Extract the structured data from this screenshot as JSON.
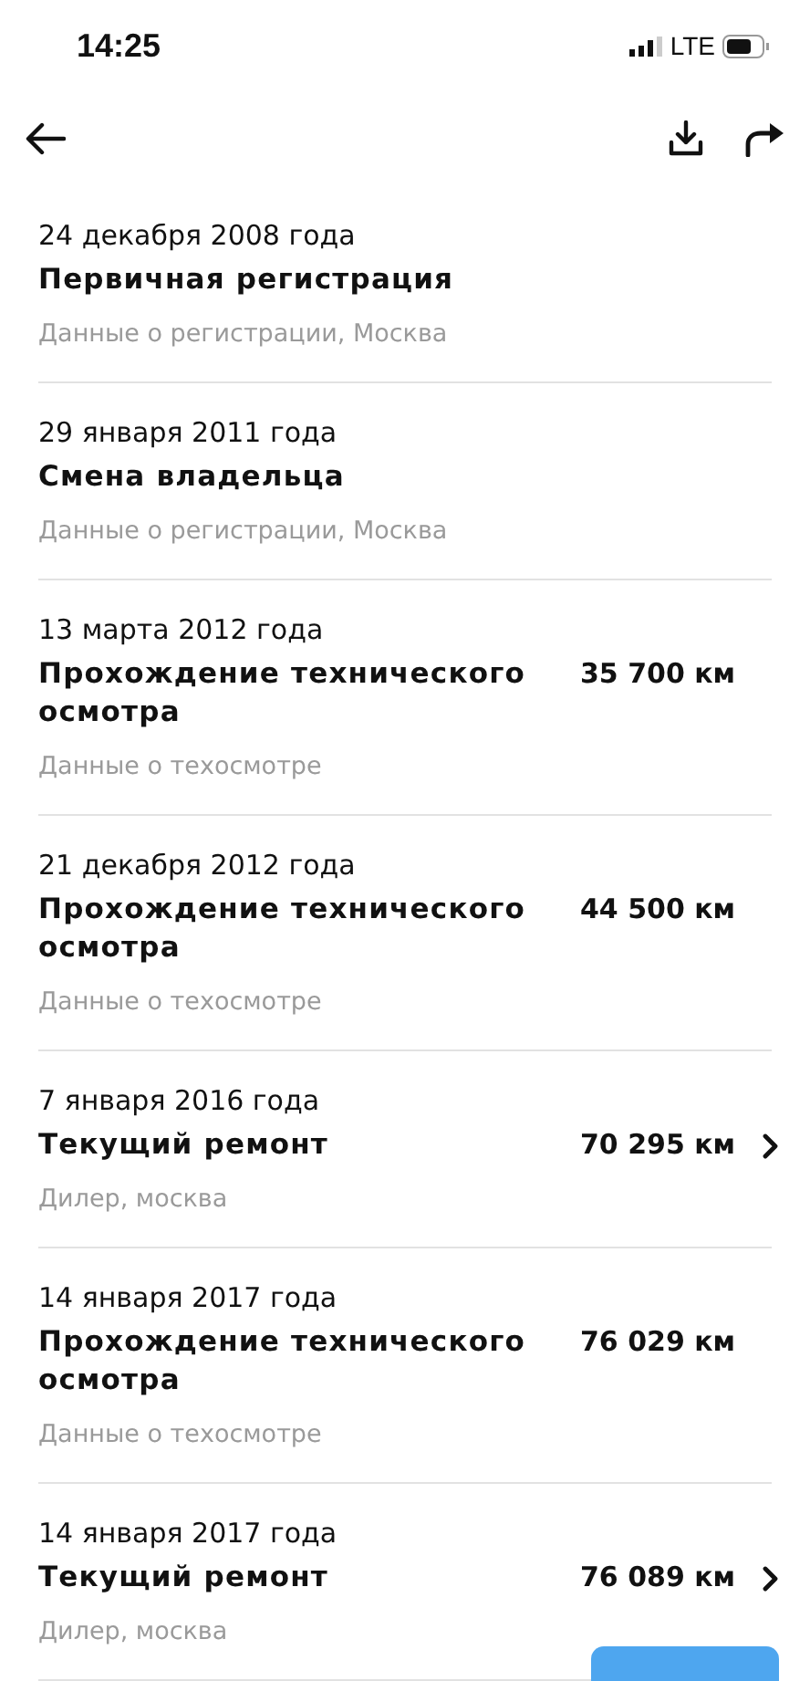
{
  "status_bar": {
    "time": "14:25",
    "network": "LTE"
  },
  "events": [
    {
      "date": "24 декабря 2008 года",
      "title": "Первичная регистрация",
      "source": "Данные о регистрации, Москва",
      "has_details": false
    },
    {
      "date": "29 января 2011 года",
      "title": "Смена владельца",
      "source": "Данные о регистрации, Москва",
      "has_details": false
    },
    {
      "date": "13 марта 2012 года",
      "title": "Прохождение технического осмотра",
      "source": "Данные о техосмотре",
      "mileage": "35 700 км",
      "has_details": false
    },
    {
      "date": "21 декабря 2012 года",
      "title": "Прохождение технического осмотра",
      "source": "Данные о техосмотре",
      "mileage": "44 500 км",
      "has_details": false
    },
    {
      "date": "7 января 2016 года",
      "title": "Текущий ремонт",
      "source": "Дилер, москва",
      "mileage": "70 295 км",
      "has_details": true
    },
    {
      "date": "14 января 2017 года",
      "title": "Прохождение технического осмотра",
      "source": "Данные о техосмотре",
      "mileage": "76 029 км",
      "has_details": false
    },
    {
      "date": "14 января 2017 года",
      "title": "Текущий ремонт",
      "source": "Дилер, москва",
      "mileage": "76 089 км",
      "has_details": true
    }
  ],
  "floating_button": {
    "kind": "partial"
  }
}
